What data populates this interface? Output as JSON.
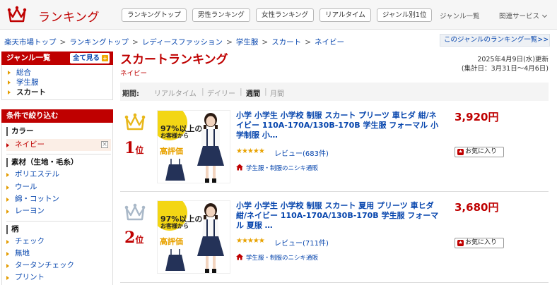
{
  "header": {
    "logo_text": "ランキング",
    "tabs": [
      "ランキングトップ",
      "男性ランキング",
      "女性ランキング",
      "リアルタイム",
      "ジャンル別1位"
    ],
    "genre_list_link": "ジャンル一覧",
    "related_services": "関連サービス"
  },
  "breadcrumb": {
    "items": [
      "楽天市場トップ",
      "ランキングトップ",
      "レディースファッション",
      "学生服",
      "スカート"
    ],
    "current": "ネイビー",
    "separator": ">"
  },
  "genre_ranking_link": "このジャンルのランキング一覧>>",
  "sidebar": {
    "genre_title": "ジャンル一覧",
    "all_button": "全て見る",
    "all_button_plus": "+",
    "genres": [
      {
        "label": "総合"
      },
      {
        "label": "学生服"
      },
      {
        "label": "スカート"
      }
    ],
    "filter_title": "条件で絞り込む",
    "groups": {
      "color": {
        "title": "カラー",
        "items": [
          "ネイビー"
        ]
      },
      "material": {
        "title": "素材（生地・毛糸）",
        "items": [
          "ポリエステル",
          "ウール",
          "綿・コットン",
          "レーヨン"
        ]
      },
      "pattern": {
        "title": "柄",
        "items": [
          "チェック",
          "無地",
          "タータンチェック",
          "プリント"
        ]
      }
    },
    "clear_icon": "×"
  },
  "main": {
    "title": "スカートランキング",
    "subtitle": "ネイビー",
    "updated": "2025年4月9日(水)更新",
    "period_range": "(集計日：3月31日〜4月6日)",
    "period_label": "期間:",
    "periods": [
      "リアルタイム",
      "デイリー",
      "週間",
      "月間"
    ],
    "active_period": "週間"
  },
  "items": [
    {
      "rank": "1",
      "rank_suffix": "位",
      "crown_color": "#e8b71a",
      "title": "小学 小学生 小学校 制服 スカート プリーツ 車ヒダ 紺/ネイビー 110A-170A/130B-170B 学生服 フォーマル 小学制服 小…",
      "stars": "★★★★★",
      "review": "レビュー(683件)",
      "shop": "学生服・制服のニシキ通販",
      "price": "3,920円",
      "fav": "お気に入り",
      "badge_line1": "97%以上の",
      "badge_line2": "お客様から",
      "badge_line3": "高評価"
    },
    {
      "rank": "2",
      "rank_suffix": "位",
      "crown_color": "#a9b8c8",
      "title": "小学 小学生 小学校 制服 スカート 夏用 プリーツ 車ヒダ 紺/ネイビー 110A-170A/130B-170B 学生服 フォーマル 夏服 …",
      "stars": "★★★★★",
      "review": "レビュー(711件)",
      "shop": "学生服・制服のニシキ通販",
      "price": "3,680円",
      "fav": "お気に入り",
      "badge_line1": "97%以上の",
      "badge_line2": "お客様から",
      "badge_line3": "高評価"
    }
  ],
  "colors": {
    "brand_red": "#bf0000",
    "link_blue": "#0645ad",
    "star_gold": "#e8a200"
  }
}
